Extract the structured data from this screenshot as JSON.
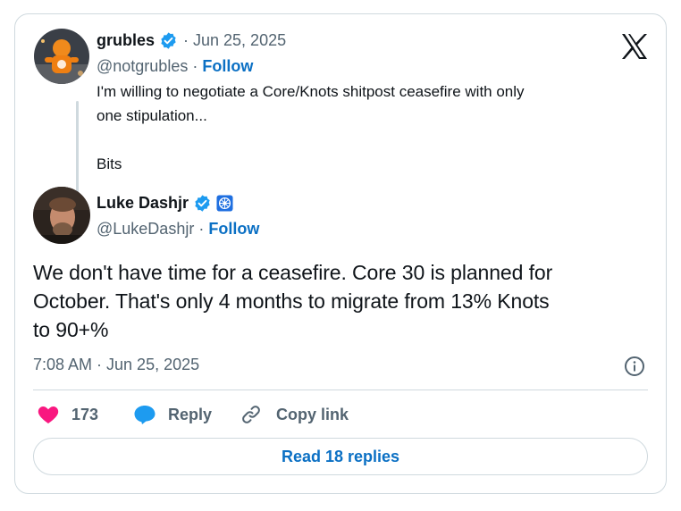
{
  "quoted": {
    "name": "grubles",
    "date": "Jun 25, 2025",
    "handle": "@notgrubles",
    "follow_label": "Follow",
    "text_line1": "I'm willing to negotiate a Core/Knots shitpost ceasefire with only",
    "text_line2": "one stipulation...",
    "text_line3": "Bits"
  },
  "main": {
    "name": "Luke Dashjr",
    "handle": "@LukeDashjr",
    "follow_label": "Follow",
    "text_line1": "We don't have time for a ceasefire. Core 30 is planned for",
    "text_line2": "October. That's only 4 months to migrate from 13% Knots",
    "text_line3": "to 90+%",
    "timestamp": "7:08 AM · Jun 25, 2025"
  },
  "actions": {
    "like_count": "173",
    "reply_label": "Reply",
    "copy_label": "Copy link"
  },
  "read_replies_label": "Read 18 replies",
  "separator": "·",
  "colors": {
    "verified": "#1d9bf0",
    "link": "#0b70c4",
    "like": "#f91880",
    "muted": "#536471",
    "border": "#cfd9de"
  },
  "icons": [
    "x-logo-icon",
    "verified-badge-icon",
    "heart-icon",
    "reply-bubble-icon",
    "link-icon",
    "info-icon",
    "affiliate-badge-icon"
  ]
}
